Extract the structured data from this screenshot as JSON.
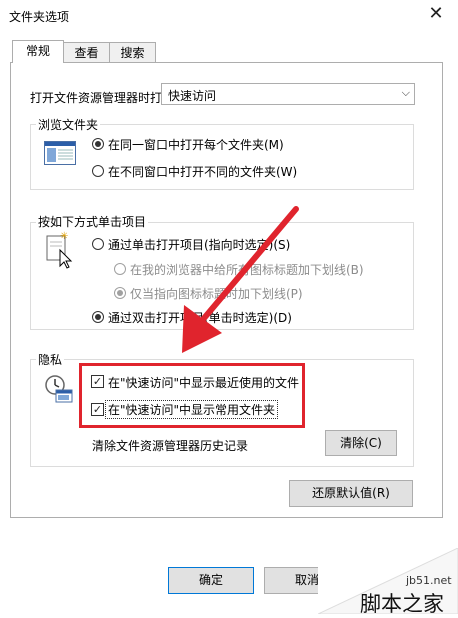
{
  "window": {
    "title": "文件夹选项",
    "close_icon": "close-icon"
  },
  "tabs": [
    {
      "label": "常规",
      "active": true
    },
    {
      "label": "查看",
      "active": false
    },
    {
      "label": "搜索",
      "active": false
    }
  ],
  "open_explorer": {
    "label": "打开文件资源管理器时打",
    "value": "快速访问"
  },
  "browse": {
    "legend": "浏览文件夹",
    "icon": "window-icon",
    "options": [
      {
        "label": "在同一窗口中打开每个文件夹(M)",
        "selected": true
      },
      {
        "label": "在不同窗口中打开不同的文件夹(W)",
        "selected": false
      }
    ]
  },
  "click_items": {
    "legend": "按如下方式单击项目",
    "icon": "pointer-icon",
    "options": [
      {
        "label": "通过单击打开项目(指向时选定)(S)",
        "selected": false,
        "disabled": false
      },
      {
        "label": "在我的浏览器中给所有图标标题加下划线(B)",
        "selected": false,
        "disabled": true
      },
      {
        "label": "仅当指向图标标题时加下划线(P)",
        "selected": true,
        "disabled": true
      },
      {
        "label": "通过双击打开项目(单击时选定)(D)",
        "selected": true,
        "disabled": false
      }
    ]
  },
  "privacy": {
    "legend": "隐私",
    "icon": "privacy-icon",
    "checks": [
      {
        "label": "在\"快速访问\"中显示最近使用的文件",
        "checked": true
      },
      {
        "label": "在\"快速访问\"中显示常用文件夹",
        "checked": true
      }
    ],
    "clear_label": "清除文件资源管理器历史记录",
    "clear_button": "清除(C)"
  },
  "restore_button": "还原默认值(R)",
  "footer": {
    "ok": "确定",
    "cancel": "取消"
  },
  "watermark": {
    "brand": "脚本之家",
    "site": "jb51.net"
  },
  "colors": {
    "highlight_red": "#e0242d",
    "focus_blue": "#0078d7"
  }
}
